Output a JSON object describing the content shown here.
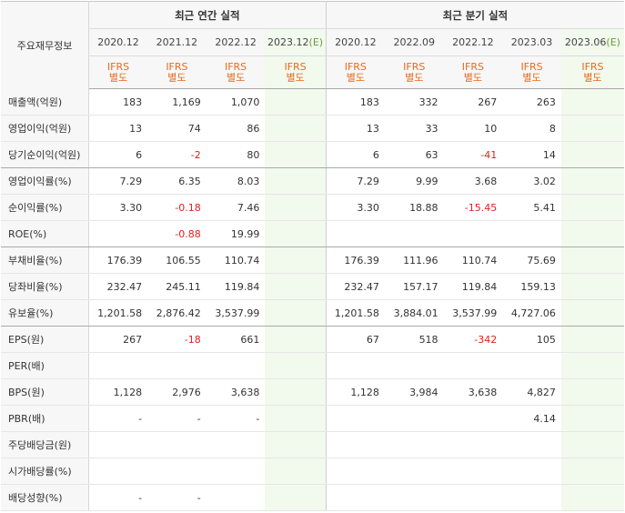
{
  "header": {
    "row_label": "주요재무정보",
    "annual_title": "최근 연간 실적",
    "quarter_title": "최근 분기 실적",
    "annual_years": [
      "2020.12",
      "2021.12",
      "2022.12",
      "2023.12"
    ],
    "annual_est_suffix": "(E)",
    "quarter_periods": [
      "2020.12",
      "2022.09",
      "2022.12",
      "2023.03",
      "2023.06"
    ],
    "quarter_est_suffix": "(E)",
    "ifrs_top": "IFRS",
    "ifrs_bottom": "별도"
  },
  "rows": [
    {
      "label": "매출액(억원)",
      "annual": [
        "183",
        "1,169",
        "1,070",
        ""
      ],
      "quarter": [
        "183",
        "332",
        "267",
        "263",
        ""
      ]
    },
    {
      "label": "영업이익(억원)",
      "annual": [
        "13",
        "74",
        "86",
        ""
      ],
      "quarter": [
        "13",
        "33",
        "10",
        "8",
        ""
      ]
    },
    {
      "label": "당기순이익(억원)",
      "annual": [
        "6",
        "-2",
        "80",
        ""
      ],
      "quarter": [
        "6",
        "63",
        "-41",
        "14",
        ""
      ]
    },
    {
      "label": "영업이익률(%)",
      "annual": [
        "7.29",
        "6.35",
        "8.03",
        ""
      ],
      "quarter": [
        "7.29",
        "9.99",
        "3.68",
        "3.02",
        ""
      ]
    },
    {
      "label": "순이익률(%)",
      "annual": [
        "3.30",
        "-0.18",
        "7.46",
        ""
      ],
      "quarter": [
        "3.30",
        "18.88",
        "-15.45",
        "5.41",
        ""
      ]
    },
    {
      "label": "ROE(%)",
      "annual": [
        "",
        "-0.88",
        "19.99",
        ""
      ],
      "quarter": [
        "",
        "",
        "",
        "",
        ""
      ]
    },
    {
      "label": "부채비율(%)",
      "annual": [
        "176.39",
        "106.55",
        "110.74",
        ""
      ],
      "quarter": [
        "176.39",
        "111.96",
        "110.74",
        "75.69",
        ""
      ]
    },
    {
      "label": "당좌비율(%)",
      "annual": [
        "232.47",
        "245.11",
        "119.84",
        ""
      ],
      "quarter": [
        "232.47",
        "157.17",
        "119.84",
        "159.13",
        ""
      ]
    },
    {
      "label": "유보율(%)",
      "annual": [
        "1,201.58",
        "2,876.42",
        "3,537.99",
        ""
      ],
      "quarter": [
        "1,201.58",
        "3,884.01",
        "3,537.99",
        "4,727.06",
        ""
      ]
    },
    {
      "label": "EPS(원)",
      "annual": [
        "267",
        "-18",
        "661",
        ""
      ],
      "quarter": [
        "67",
        "518",
        "-342",
        "105",
        ""
      ]
    },
    {
      "label": "PER(배)",
      "annual": [
        "",
        "",
        "",
        ""
      ],
      "quarter": [
        "",
        "",
        "",
        "",
        ""
      ]
    },
    {
      "label": "BPS(원)",
      "annual": [
        "1,128",
        "2,976",
        "3,638",
        ""
      ],
      "quarter": [
        "1,128",
        "3,984",
        "3,638",
        "4,827",
        ""
      ]
    },
    {
      "label": "PBR(배)",
      "annual": [
        "-",
        "-",
        "-",
        ""
      ],
      "quarter": [
        "",
        "",
        "",
        "4.14",
        ""
      ]
    },
    {
      "label": "주당배당금(원)",
      "annual": [
        "",
        "",
        "",
        ""
      ],
      "quarter": [
        "",
        "",
        "",
        "",
        ""
      ]
    },
    {
      "label": "시가배당률(%)",
      "annual": [
        "",
        "",
        "",
        ""
      ],
      "quarter": [
        "",
        "",
        "",
        "",
        ""
      ]
    },
    {
      "label": "배당성향(%)",
      "annual": [
        "-",
        "-",
        "",
        ""
      ],
      "quarter": [
        "",
        "",
        "",
        "",
        ""
      ]
    }
  ],
  "colors": {
    "negative": "#e02020",
    "ifrs": "#e96a1e",
    "estimate": "#6a9e3b",
    "estimate_bg": "#f2f9ed"
  }
}
